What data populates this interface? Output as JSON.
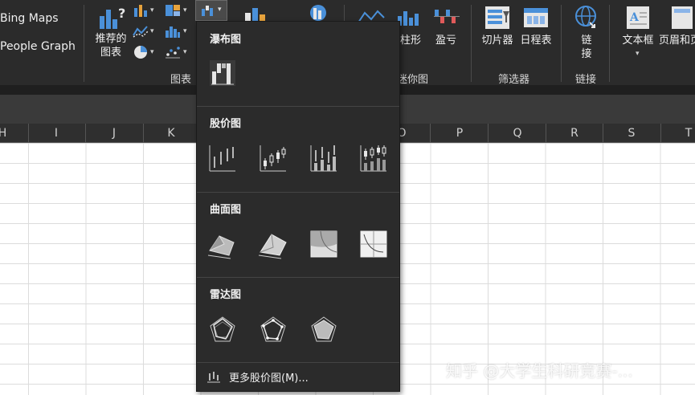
{
  "addins": {
    "bing_maps": "Bing Maps",
    "people_graph": "People Graph"
  },
  "ribbon": {
    "recommended_charts": [
      "推荐的",
      "图表"
    ],
    "charts_group": "图表",
    "sparkline_line_label": "柱形",
    "sparkline_winloss_label": "盈亏",
    "sparklines_group": "迷你图",
    "slicer": "切片器",
    "timeline": "日程表",
    "filters_group": "筛选器",
    "link": [
      "链",
      "接"
    ],
    "links_group": "链接",
    "textbox": "文本框",
    "header_footer": "页眉和页"
  },
  "columns": [
    "H",
    "I",
    "J",
    "K",
    "O",
    "P",
    "Q",
    "R",
    "S",
    "T"
  ],
  "dropdown": {
    "sections": {
      "waterfall": "瀑布图",
      "stock": "股价图",
      "surface": "曲面图",
      "radar": "雷达图"
    },
    "more_link": "更多股价图(M)..."
  },
  "watermark": "知乎 @大学生科研竞赛-...",
  "colors": {
    "ribbon_bg": "#2b2b2b",
    "menu_bg": "#2b2b2b",
    "accent_blue": "#4a90d9"
  }
}
